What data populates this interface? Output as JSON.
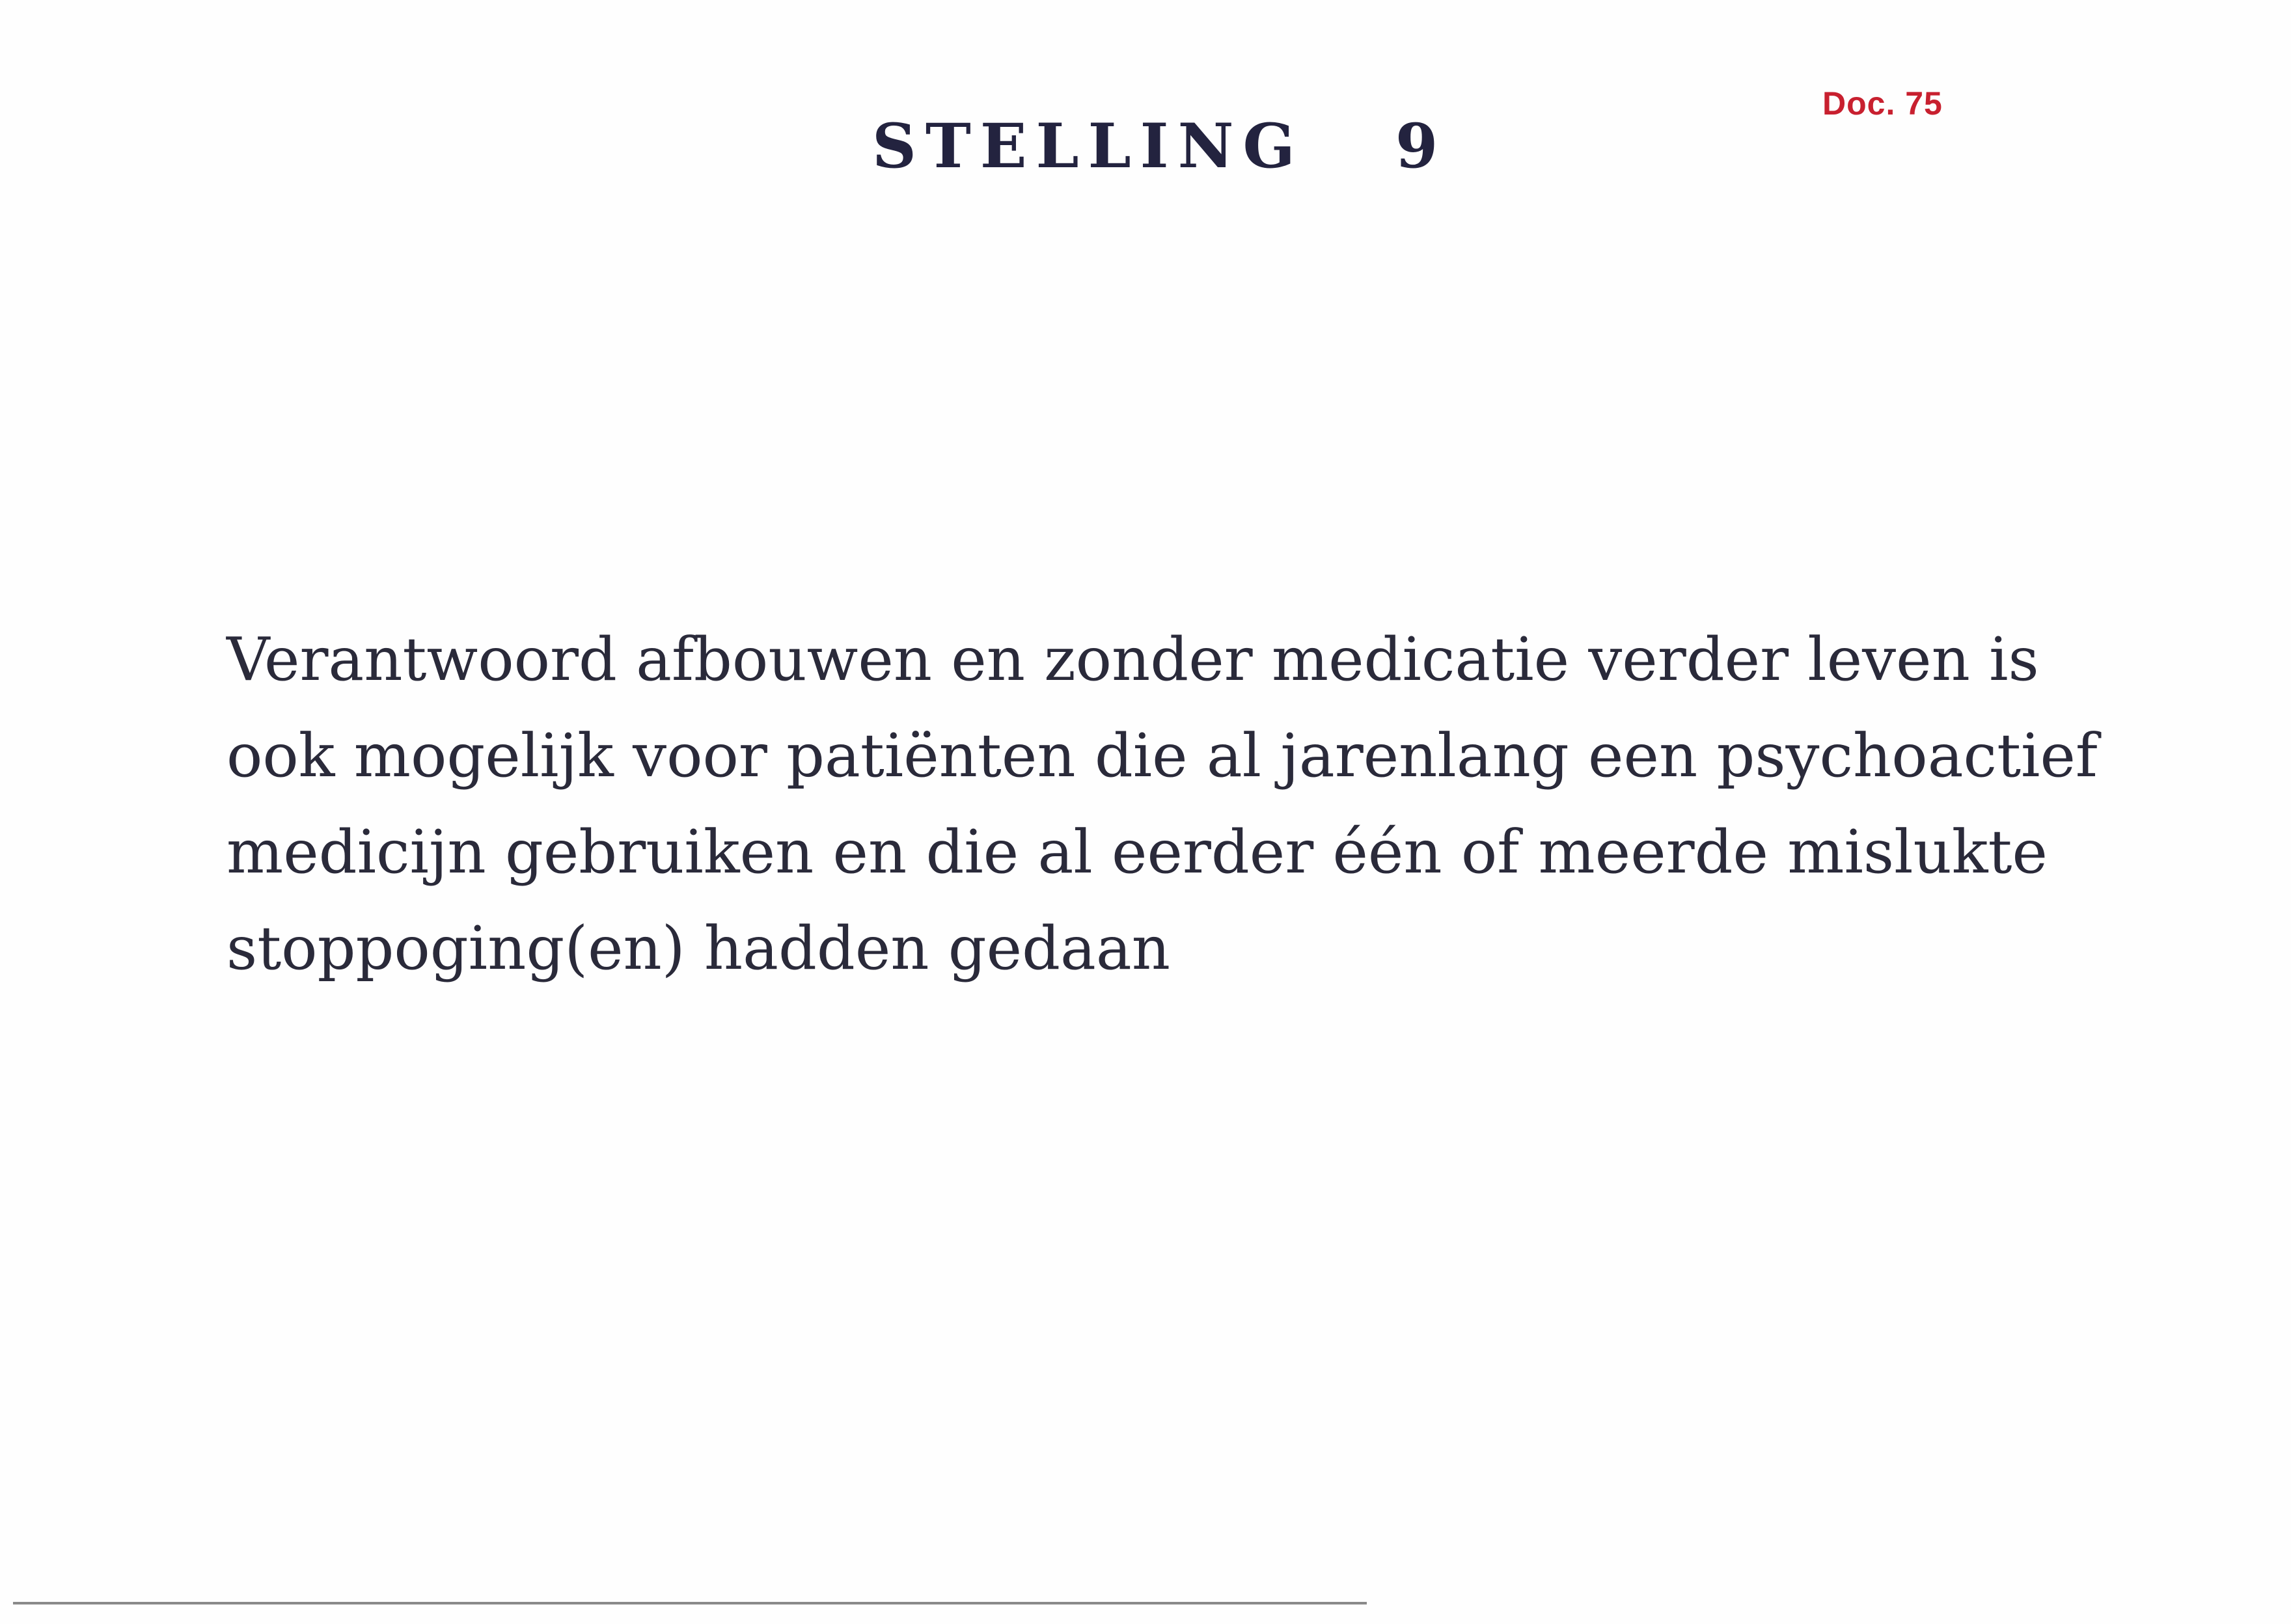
{
  "doc_label": "Doc. 75",
  "heading": {
    "title": "STELLING",
    "number": "9"
  },
  "statement": {
    "lines": [
      "Verantwoord afbouwen en zonder medicatie verder leven is",
      "ook mogelijk voor patiënten die al jarenlang een psychoactief",
      "medicijn gebruiken en die al eerder één of meerde mislukte",
      "stoppoging(en) hadden gedaan"
    ]
  },
  "colors": {
    "doc_label": "#c8202f",
    "heading": "#23233f",
    "text": "#2a2a3a"
  }
}
